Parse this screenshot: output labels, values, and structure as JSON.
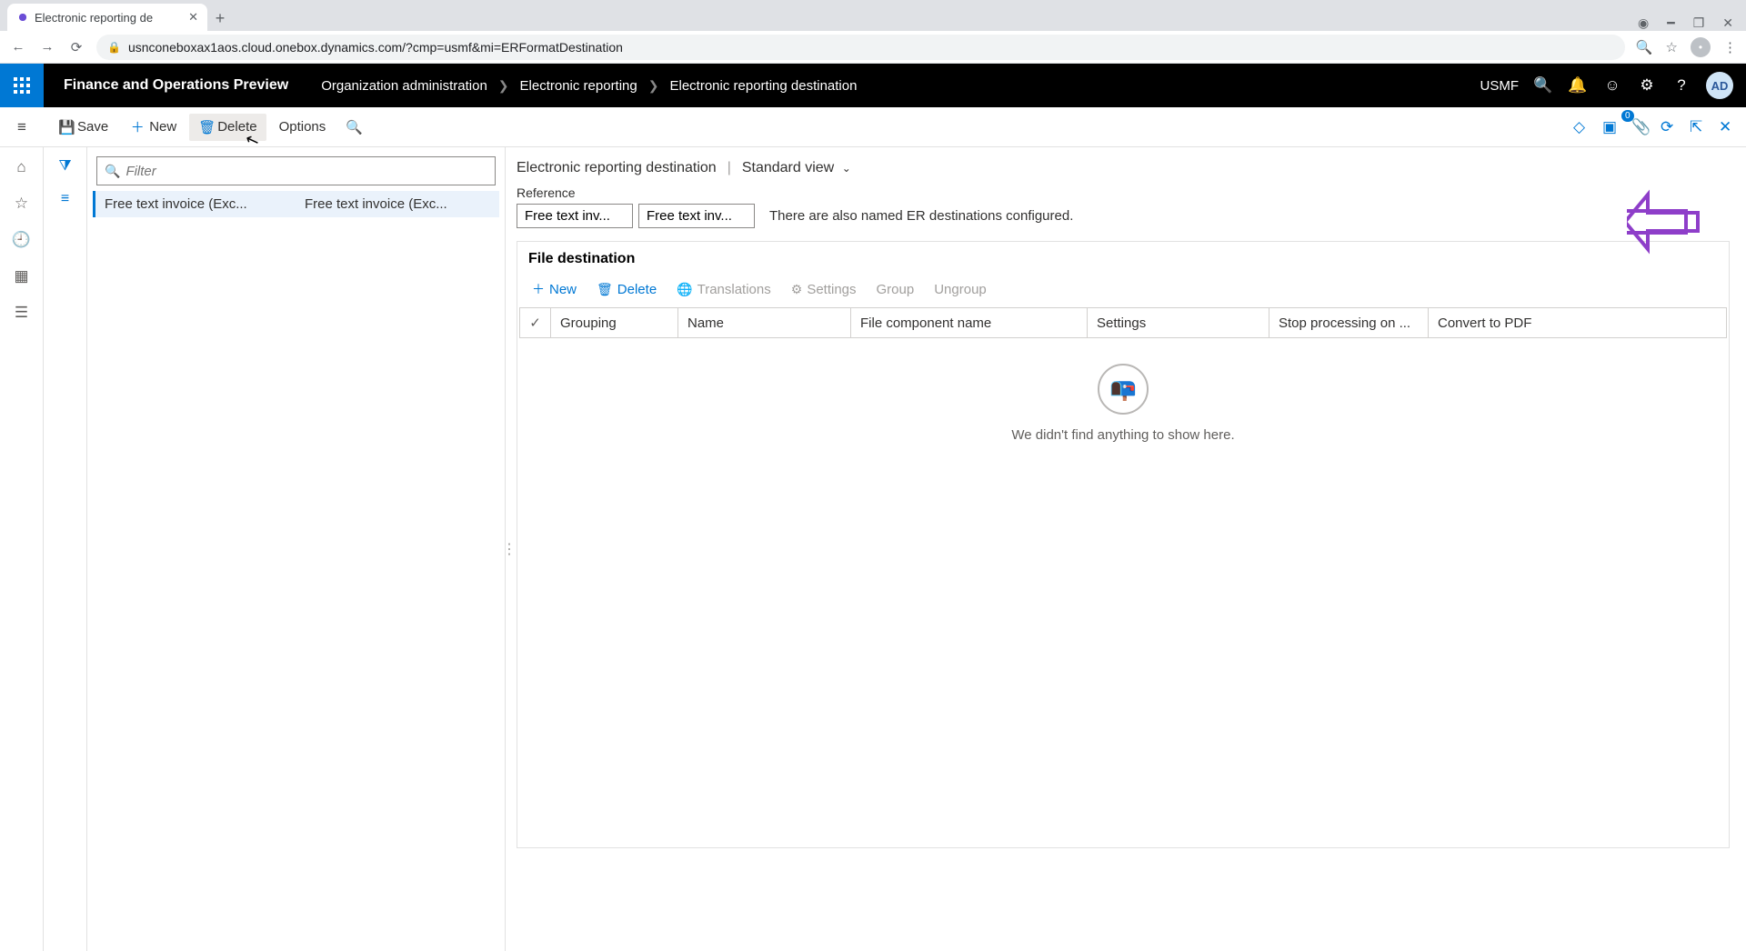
{
  "browser": {
    "tab_title": "Electronic reporting de",
    "url": "usnconeboxax1aos.cloud.onebox.dynamics.com/?cmp=usmf&mi=ERFormatDestination"
  },
  "header": {
    "brand": "Finance and Operations Preview",
    "breadcrumbs": [
      "Organization administration",
      "Electronic reporting",
      "Electronic reporting destination"
    ],
    "company": "USMF",
    "avatar": "AD"
  },
  "action_pane": {
    "save": "Save",
    "new": "New",
    "delete": "Delete",
    "options": "Options",
    "attach_count": "0"
  },
  "list": {
    "filter_placeholder": "Filter",
    "rows": [
      {
        "c1": "Free text invoice (Exc...",
        "c2": "Free text invoice (Exc..."
      }
    ]
  },
  "main": {
    "page_title": "Electronic reporting destination",
    "view_label": "Standard view",
    "reference_label": "Reference",
    "reference_values": [
      "Free text inv...",
      "Free text inv..."
    ],
    "reference_info": "There are also named ER destinations configured.",
    "file_section_title": "File destination",
    "grid_buttons": {
      "new": "New",
      "delete": "Delete",
      "translations": "Translations",
      "settings": "Settings",
      "group": "Group",
      "ungroup": "Ungroup"
    },
    "grid_columns": {
      "grouping": "Grouping",
      "name": "Name",
      "file_component": "File component name",
      "settings": "Settings",
      "stop": "Stop processing on ...",
      "convert_pdf": "Convert to PDF"
    },
    "empty_text": "We didn't find anything to show here."
  }
}
